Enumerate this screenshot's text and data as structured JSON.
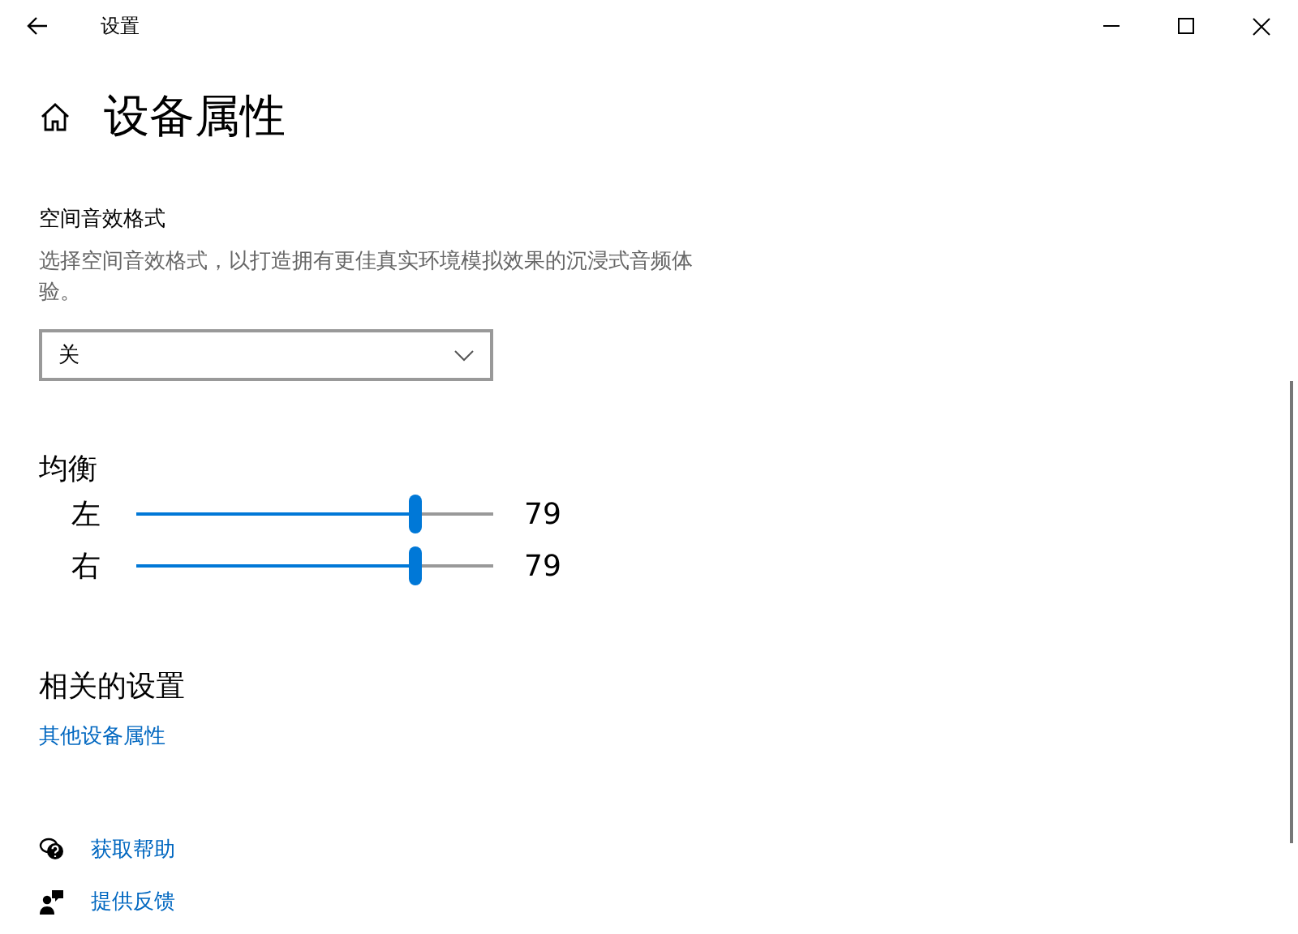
{
  "window": {
    "title": "设置"
  },
  "page": {
    "title": "设备属性"
  },
  "spatial_format": {
    "label": "空间音效格式",
    "description": "选择空间音效格式，以打造拥有更佳真实环境模拟效果的沉浸式音频体验。",
    "dropdown": {
      "value": "关"
    }
  },
  "balance": {
    "title": "均衡",
    "channels": [
      {
        "name": "左",
        "level": 0.78,
        "reading": "79"
      },
      {
        "name": "右",
        "level": 0.78,
        "reading": "79"
      }
    ]
  },
  "related": {
    "title": "相关的设置",
    "links": [
      "其他设备属性"
    ]
  },
  "help_links": [
    {
      "kind": "help",
      "label": "获取帮助"
    },
    {
      "kind": "feedback",
      "label": "提供反馈"
    }
  ]
}
